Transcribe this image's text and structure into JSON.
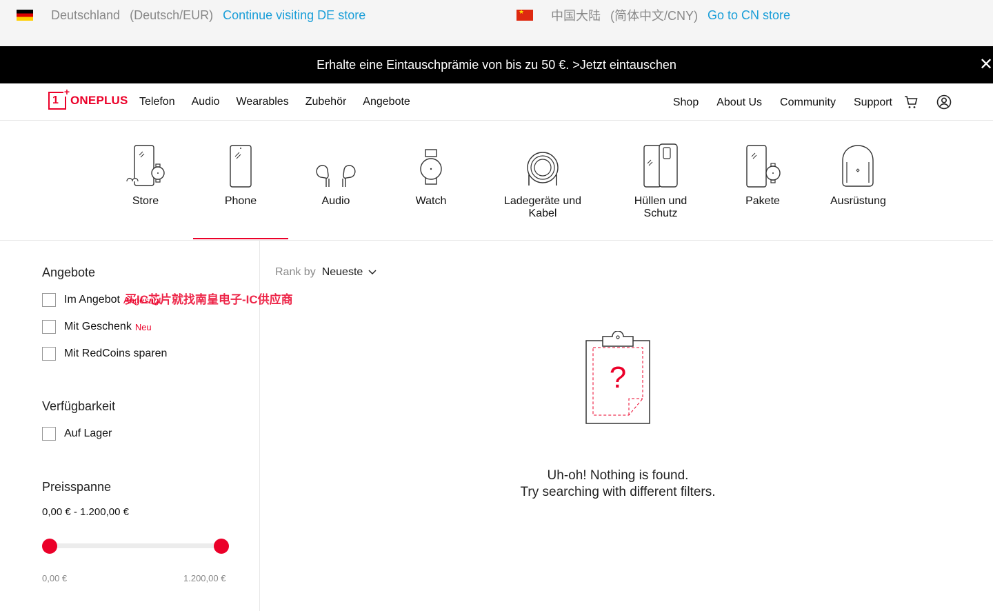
{
  "region_bar": {
    "de": {
      "country": "Deutschland",
      "lang": "(Deutsch/EUR)",
      "link": "Continue visiting DE store"
    },
    "cn": {
      "country": "中国大陆",
      "lang": "(简体中文/CNY)",
      "link": "Go to CN store"
    }
  },
  "promo": {
    "text": "Erhalte eine Eintauschprämie von bis zu 50 €. >Jetzt eintauschen",
    "close": "✕"
  },
  "header": {
    "logo_text": "ONEPLUS",
    "nav_left": [
      "Telefon",
      "Audio",
      "Wearables",
      "Zubehör",
      "Angebote"
    ],
    "nav_right": [
      "Shop",
      "About Us",
      "Community",
      "Support"
    ],
    "icons": [
      "cart-icon",
      "user-icon"
    ]
  },
  "categories": [
    {
      "label": "Store",
      "icon": "store-icon"
    },
    {
      "label": "Phone",
      "icon": "phone-icon",
      "active": true
    },
    {
      "label": "Audio",
      "icon": "earbuds-icon"
    },
    {
      "label": "Watch",
      "icon": "watch-icon"
    },
    {
      "label": "Ladegeräte und Kabel",
      "icon": "cable-icon"
    },
    {
      "label": "Hüllen und Schutz",
      "icon": "case-icon"
    },
    {
      "label": "Pakete",
      "icon": "bundle-icon"
    },
    {
      "label": "Ausrüstung",
      "icon": "backpack-icon"
    }
  ],
  "filters": {
    "offers": {
      "title": "Angebote",
      "items": [
        {
          "label": "Im Angebot",
          "tag": "Angesagt"
        },
        {
          "label": "Mit Geschenk",
          "tag": "Neu"
        },
        {
          "label": "Mit RedCoins sparen",
          "tag": ""
        }
      ]
    },
    "availability": {
      "title": "Verfügbarkeit",
      "items": [
        {
          "label": "Auf Lager"
        }
      ]
    },
    "price": {
      "title": "Preisspanne",
      "range_text": "0,00 € - 1.200,00 €",
      "min_label": "0,00 €",
      "max_label": "1.200,00 €",
      "min_value": 0,
      "max_value": 1200
    }
  },
  "sort": {
    "label": "Rank by",
    "value": "Neueste"
  },
  "empty_state": {
    "line1": "Uh-oh! Nothing is found.",
    "line2": "Try searching with different filters.",
    "symbol": "?"
  },
  "watermark": "买IC芯片就找南皇电子-IC供应商",
  "colors": {
    "accent": "#eb0029",
    "link": "#1a9ed8",
    "promo_bg": "#000000"
  }
}
